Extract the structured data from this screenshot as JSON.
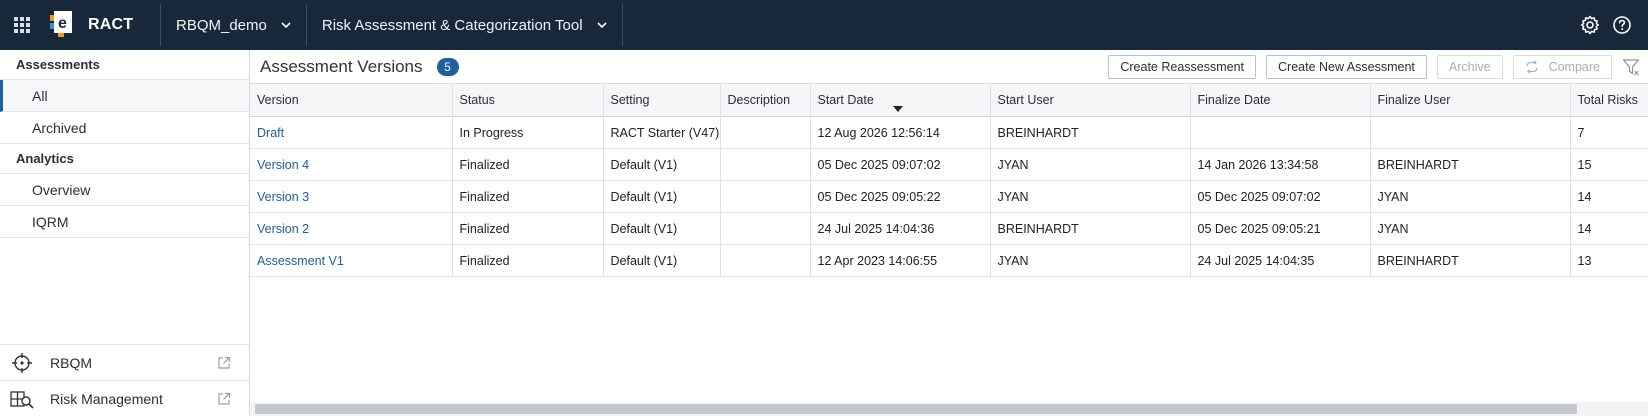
{
  "app": {
    "name": "RACT",
    "study": "RBQM_demo",
    "tool": "Risk Assessment & Categorization Tool",
    "icons": [
      "apps-grid-icon",
      "settings-gear-icon",
      "help-icon",
      "chevron-down-icon"
    ]
  },
  "sidebar": {
    "assessments_heading": "Assessments",
    "assessments_items": [
      {
        "label": "All",
        "active": true
      },
      {
        "label": "Archived",
        "active": false
      }
    ],
    "analytics_heading": "Analytics",
    "analytics_items": [
      {
        "label": "Overview"
      },
      {
        "label": "IQRM"
      }
    ],
    "links": [
      {
        "label": "RBQM",
        "icon": "crosshair-icon"
      },
      {
        "label": "Risk Management",
        "icon": "risk-search-icon"
      }
    ]
  },
  "main": {
    "title": "Assessment Versions",
    "count": "5",
    "buttons": {
      "reassessment": "Create Reassessment",
      "new_assessment": "Create New Assessment",
      "archive": "Archive",
      "compare": "Compare"
    },
    "columns": [
      "Version",
      "Status",
      "Setting",
      "Description",
      "Start Date",
      "Start User",
      "Finalize Date",
      "Finalize User",
      "Total Risks"
    ],
    "sort": {
      "column": "Start Date",
      "direction": "descending"
    },
    "rows": [
      {
        "version": "Draft",
        "status": "In Progress",
        "setting": "RACT Starter (V47)",
        "description": "",
        "start_date": "12 Aug 2026 12:56:14",
        "start_user": "BREINHARDT",
        "finalize_date": "",
        "finalize_user": "",
        "total_risks": "7"
      },
      {
        "version": "Version 4",
        "status": "Finalized",
        "setting": "Default (V1)",
        "description": "",
        "start_date": "05 Dec 2025 09:07:02",
        "start_user": "JYAN",
        "finalize_date": "14 Jan 2026 13:34:58",
        "finalize_user": "BREINHARDT",
        "total_risks": "15"
      },
      {
        "version": "Version 3",
        "status": "Finalized",
        "setting": "Default (V1)",
        "description": "",
        "start_date": "05 Dec 2025 09:05:22",
        "start_user": "JYAN",
        "finalize_date": "05 Dec 2025 09:07:02",
        "finalize_user": "JYAN",
        "total_risks": "14"
      },
      {
        "version": "Version 2",
        "status": "Finalized",
        "setting": "Default (V1)",
        "description": "",
        "start_date": "24 Jul 2025 14:04:36",
        "start_user": "BREINHARDT",
        "finalize_date": "05 Dec 2025 09:05:21",
        "finalize_user": "JYAN",
        "total_risks": "14"
      },
      {
        "version": "Assessment V1",
        "status": "Finalized",
        "setting": "Default (V1)",
        "description": "",
        "start_date": "12 Apr 2023 14:06:55",
        "start_user": "JYAN",
        "finalize_date": "24 Jul 2025 14:04:35",
        "finalize_user": "BREINHARDT",
        "total_risks": "13"
      }
    ]
  },
  "colors": {
    "topbar": "#16283a",
    "accent": "#1f5fa0",
    "logo_orange": "#f7941d",
    "logo_blue": "#3a8fd6"
  }
}
